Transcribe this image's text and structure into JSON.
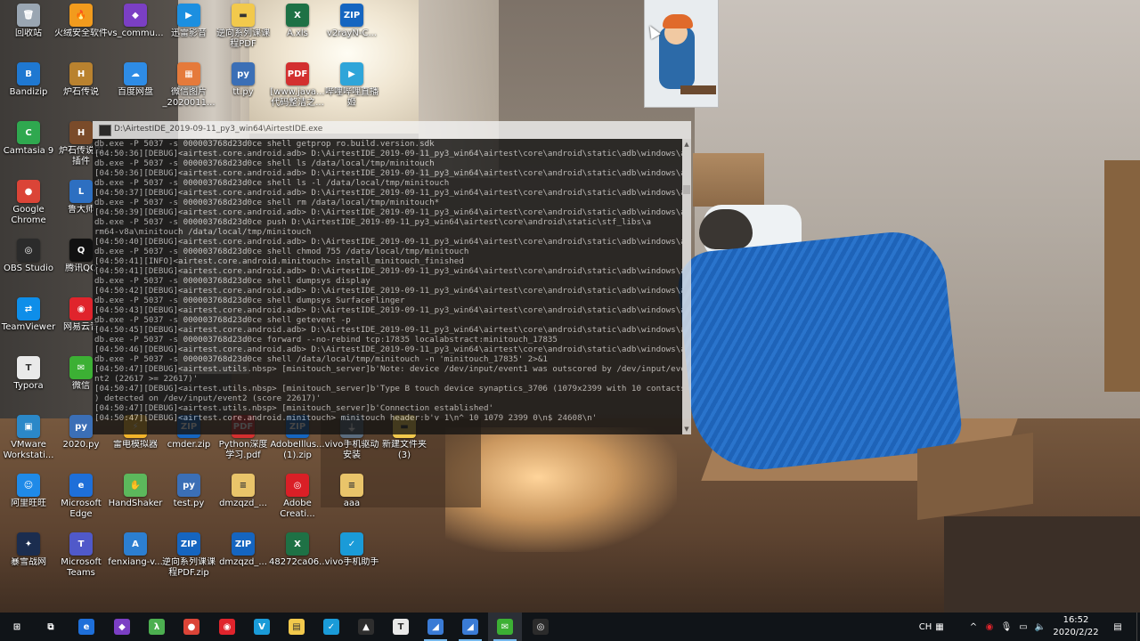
{
  "desktop": {
    "icons": [
      {
        "label": "回收站",
        "icon": "recycle-bin-icon",
        "color": "#9aa6b2"
      },
      {
        "label": "火绒安全软件",
        "icon": "huorong-icon",
        "color": "#f29b1d"
      },
      {
        "label": "vs_commu...",
        "icon": "visual-studio-icon",
        "color": "#7b3fc4"
      },
      {
        "label": "迅雷影音",
        "icon": "xunlei-player-icon",
        "color": "#1c8fe0"
      },
      {
        "label": "逆向系列课课\n程PDF",
        "icon": "folder-icon",
        "color": "#f2c94c"
      },
      {
        "label": "A.xls",
        "icon": "excel-icon",
        "color": "#1e7145"
      },
      {
        "label": "v2rayN-C...",
        "icon": "zip-icon",
        "color": "#1565c0"
      },
      {
        "label": "Bandizip",
        "icon": "bandizip-icon",
        "color": "#1f78d1"
      },
      {
        "label": "炉石传说",
        "icon": "hearthstone-icon",
        "color": "#b9822f"
      },
      {
        "label": "百度网盘",
        "icon": "baidu-netdisk-icon",
        "color": "#2e8ce6"
      },
      {
        "label": "微信图片\n_2020011...",
        "icon": "image-file-icon",
        "color": "#e57a3b"
      },
      {
        "label": "tt.py",
        "icon": "python-file-icon",
        "color": "#3b6fb6"
      },
      {
        "label": "[www.java...\n代码整洁之...",
        "icon": "pdf-icon",
        "color": "#d32f2f"
      },
      {
        "label": "哔哩哔哩直播\n姬",
        "icon": "bilibili-icon",
        "color": "#2fa5d9"
      },
      {
        "label": "Camtasia 9",
        "icon": "camtasia-icon",
        "color": "#2fa84f"
      },
      {
        "label": "炉石传说国\n插件",
        "icon": "hearthstone-plugin-icon",
        "color": "#7a4b2a"
      },
      {
        "label": "Google\nChrome",
        "icon": "chrome-icon",
        "color": "#db4437"
      },
      {
        "label": "鲁大师",
        "icon": "ludashi-icon",
        "color": "#2d6fc1"
      },
      {
        "label": "OBS Studio",
        "icon": "obs-icon",
        "color": "#2b2b2b"
      },
      {
        "label": "腾讯QQ",
        "icon": "qq-icon",
        "color": "#111111"
      },
      {
        "label": "TeamViewer",
        "icon": "teamviewer-icon",
        "color": "#0e8ee9"
      },
      {
        "label": "网易云音",
        "icon": "netease-music-icon",
        "color": "#e0242c"
      },
      {
        "label": "Typora",
        "icon": "typora-icon",
        "color": "#e9e9e9"
      },
      {
        "label": "微信",
        "icon": "wechat-icon",
        "color": "#3cb034"
      },
      {
        "label": "VMware\nWorkstati...",
        "icon": "vmware-icon",
        "color": "#2b88c8"
      },
      {
        "label": "2020.py",
        "icon": "python-file-icon",
        "color": "#3b6fb6"
      },
      {
        "label": "雷电模拟器",
        "icon": "ldplayer-icon",
        "color": "#f2b42a"
      },
      {
        "label": "cmder.zip",
        "icon": "zip-icon",
        "color": "#1565c0"
      },
      {
        "label": "Python深度\n学习.pdf",
        "icon": "pdf-icon",
        "color": "#d32f2f"
      },
      {
        "label": "AdobeIllus...\n(1).zip",
        "icon": "zip-icon",
        "color": "#1565c0"
      },
      {
        "label": "vivo手机驱动\n安装",
        "icon": "usb-driver-icon",
        "color": "#5a6b7d"
      },
      {
        "label": "新建文件夹\n(3)",
        "icon": "folder-icon",
        "color": "#f2c94c"
      },
      {
        "label": "阿里旺旺",
        "icon": "aliwangwang-icon",
        "color": "#1f8ae8"
      },
      {
        "label": "Microsoft\nEdge",
        "icon": "edge-icon",
        "color": "#1e6fd9"
      },
      {
        "label": "HandShaker",
        "icon": "handshaker-icon",
        "color": "#5cb85c"
      },
      {
        "label": "test.py",
        "icon": "python-file-icon",
        "color": "#3b6fb6"
      },
      {
        "label": "dmzqzd_...",
        "icon": "document-icon",
        "color": "#e9c46a"
      },
      {
        "label": "Adobe\nCreati...",
        "icon": "adobe-cc-icon",
        "color": "#da1f26"
      },
      {
        "label": "aaa",
        "icon": "document-icon",
        "color": "#e9c46a"
      },
      {
        "label": "暴雪战网",
        "icon": "battlenet-icon",
        "color": "#1b2d4f"
      },
      {
        "label": "Microsoft\nTeams",
        "icon": "teams-icon",
        "color": "#5059c9"
      },
      {
        "label": "fenxiang-v...",
        "icon": "apk-icon",
        "color": "#2c7fd1"
      },
      {
        "label": "逆向系列课课\n程PDF.zip",
        "icon": "zip-icon",
        "color": "#1565c0"
      },
      {
        "label": "dmzqzd_...",
        "icon": "zip-icon",
        "color": "#1565c0"
      },
      {
        "label": "48272ca06...",
        "icon": "excel-icon",
        "color": "#1e7145"
      },
      {
        "label": "vivo手机助手",
        "icon": "vivo-assistant-icon",
        "color": "#1a9bd8"
      }
    ]
  },
  "console": {
    "title": "D:\\AirtestIDE_2019-09-11_py3_win64\\AirtestIDE.exe",
    "lines": [
      "db.exe -P 5037 -s 000003768d23d0ce shell getprop ro.build.version.sdk",
      "[04:50:36][DEBUG]<airtest.core.android.adb> D:\\AirtestIDE_2019-09-11_py3_win64\\airtest\\core\\android\\static\\adb\\windows\\a",
      "db.exe -P 5037 -s 000003768d23d0ce shell ls /data/local/tmp/minitouch",
      "[04:50:36][DEBUG]<airtest.core.android.adb> D:\\AirtestIDE_2019-09-11_py3_win64\\airtest\\core\\android\\static\\adb\\windows\\a",
      "db.exe -P 5037 -s 000003768d23d0ce shell ls -l /data/local/tmp/minitouch",
      "[04:50:37][DEBUG]<airtest.core.android.adb> D:\\AirtestIDE_2019-09-11_py3_win64\\airtest\\core\\android\\static\\adb\\windows\\a",
      "db.exe -P 5037 -s 000003768d23d0ce shell rm /data/local/tmp/minitouch*",
      "[04:50:39][DEBUG]<airtest.core.android.adb> D:\\AirtestIDE_2019-09-11_py3_win64\\airtest\\core\\android\\static\\adb\\windows\\a",
      "db.exe -P 5037 -s 000003768d23d0ce push D:\\AirtestIDE_2019-09-11_py3_win64\\airtest\\core\\android\\static\\stf_libs\\a",
      "rm64-v8a\\minitouch /data/local/tmp/minitouch",
      "[04:50:40][DEBUG]<airtest.core.android.adb> D:\\AirtestIDE_2019-09-11_py3_win64\\airtest\\core\\android\\static\\adb\\windows\\a",
      "db.exe -P 5037 -s 000003768d23d0ce shell chmod 755 /data/local/tmp/minitouch",
      "[04:50:41][INFO]<airtest.core.android.minitouch> install_minitouch_finished",
      "[04:50:41][DEBUG]<airtest.core.android.adb> D:\\AirtestIDE_2019-09-11_py3_win64\\airtest\\core\\android\\static\\adb\\windows\\a",
      "db.exe -P 5037 -s 000003768d23d0ce shell dumpsys display",
      "[04:50:42][DEBUG]<airtest.core.android.adb> D:\\AirtestIDE_2019-09-11_py3_win64\\airtest\\core\\android\\static\\adb\\windows\\a",
      "db.exe -P 5037 -s 000003768d23d0ce shell dumpsys SurfaceFlinger",
      "[04:50:43][DEBUG]<airtest.core.android.adb> D:\\AirtestIDE_2019-09-11_py3_win64\\airtest\\core\\android\\static\\adb\\windows\\a",
      "db.exe -P 5037 -s 000003768d23d0ce shell getevent -p",
      "[04:50:45][DEBUG]<airtest.core.android.adb> D:\\AirtestIDE_2019-09-11_py3_win64\\airtest\\core\\android\\static\\adb\\windows\\a",
      "db.exe -P 5037 -s 000003768d23d0ce forward --no-rebind tcp:17835 localabstract:minitouch_17835",
      "[04:50:46][DEBUG]<airtest.core.android.adb> D:\\AirtestIDE_2019-09-11_py3_win64\\airtest\\core\\android\\static\\adb\\windows\\a",
      "db.exe -P 5037 -s 000003768d23d0ce shell /data/local/tmp/minitouch -n 'minitouch_17835' 2>&1",
      "[04:50:47][DEBUG]<airtest.utils.nbsp> [minitouch_server]b'Note: device /dev/input/event1 was outscored by /dev/input/eve",
      "nt2 (22617 >= 22617)'",
      "[04:50:47][DEBUG]<airtest.utils.nbsp> [minitouch_server]b'Type B touch device synaptics_3706 (1079x2399 with 10 contacts",
      ") detected on /dev/input/event2 (score 22617)'",
      "[04:50:47][DEBUG]<airtest.utils.nbsp> [minitouch_server]b'Connection established'",
      "[04:50:47][DEBUG]<airtest.core.android.minitouch> minitouch header:b'v 1\\n^ 10 1079 2399 0\\n$ 24608\\n'"
    ]
  },
  "taskbar": {
    "apps": [
      {
        "name": "start-button",
        "icon": "windows-logo-icon",
        "glyph": "⊞",
        "color": "#ffffff",
        "running": false
      },
      {
        "name": "task-view-button",
        "icon": "task-view-icon",
        "glyph": "⧉",
        "color": "#ffffff",
        "running": false
      },
      {
        "name": "taskbar-edge",
        "icon": "edge-icon",
        "glyph": "e",
        "color": "#1e6fd9",
        "running": false
      },
      {
        "name": "taskbar-vs",
        "icon": "visual-studio-icon",
        "glyph": "◆",
        "color": "#7b3fc4",
        "running": false
      },
      {
        "name": "taskbar-lambda",
        "icon": "lambda-icon",
        "glyph": "λ",
        "color": "#4caf50",
        "running": false
      },
      {
        "name": "taskbar-chrome",
        "icon": "chrome-icon",
        "glyph": "●",
        "color": "#db4437",
        "running": false
      },
      {
        "name": "taskbar-netease-music",
        "icon": "netease-music-icon",
        "glyph": "◉",
        "color": "#e0242c",
        "running": false
      },
      {
        "name": "taskbar-vivo",
        "icon": "vivo-icon",
        "glyph": "V",
        "color": "#1a9bd8",
        "running": false
      },
      {
        "name": "taskbar-file-explorer",
        "icon": "folder-icon",
        "glyph": "▤",
        "color": "#f2c94c",
        "running": false
      },
      {
        "name": "taskbar-vivo-assistant",
        "icon": "vivo-assistant-icon",
        "glyph": "✓",
        "color": "#1a9bd8",
        "running": false
      },
      {
        "name": "taskbar-photos",
        "icon": "photos-icon",
        "glyph": "▲",
        "color": "#2e2e2e",
        "running": false
      },
      {
        "name": "taskbar-typora",
        "icon": "typora-icon",
        "glyph": "T",
        "color": "#e9e9e9",
        "running": false
      },
      {
        "name": "taskbar-airtest-1",
        "icon": "airtest-icon",
        "glyph": "◢",
        "color": "#3a7bd5",
        "running": true
      },
      {
        "name": "taskbar-airtest-2",
        "icon": "airtest-icon",
        "glyph": "◢",
        "color": "#3a7bd5",
        "running": true
      },
      {
        "name": "taskbar-wechat",
        "icon": "wechat-icon",
        "glyph": "✉",
        "color": "#3cb034",
        "running": true
      },
      {
        "name": "taskbar-obs",
        "icon": "obs-icon",
        "glyph": "◎",
        "color": "#2b2b2b",
        "running": false
      }
    ],
    "tray": {
      "ime_mode": "CH",
      "ime_layout_icon": "keyboard-grid-icon",
      "chevron_icon": "chevron-up-icon",
      "tray_icons": [
        "netease-music-icon",
        "microphone-icon",
        "network-icon",
        "volume-icon"
      ],
      "time": "16:52",
      "date": "2020/2/22",
      "notification_icon": "notification-icon"
    }
  }
}
